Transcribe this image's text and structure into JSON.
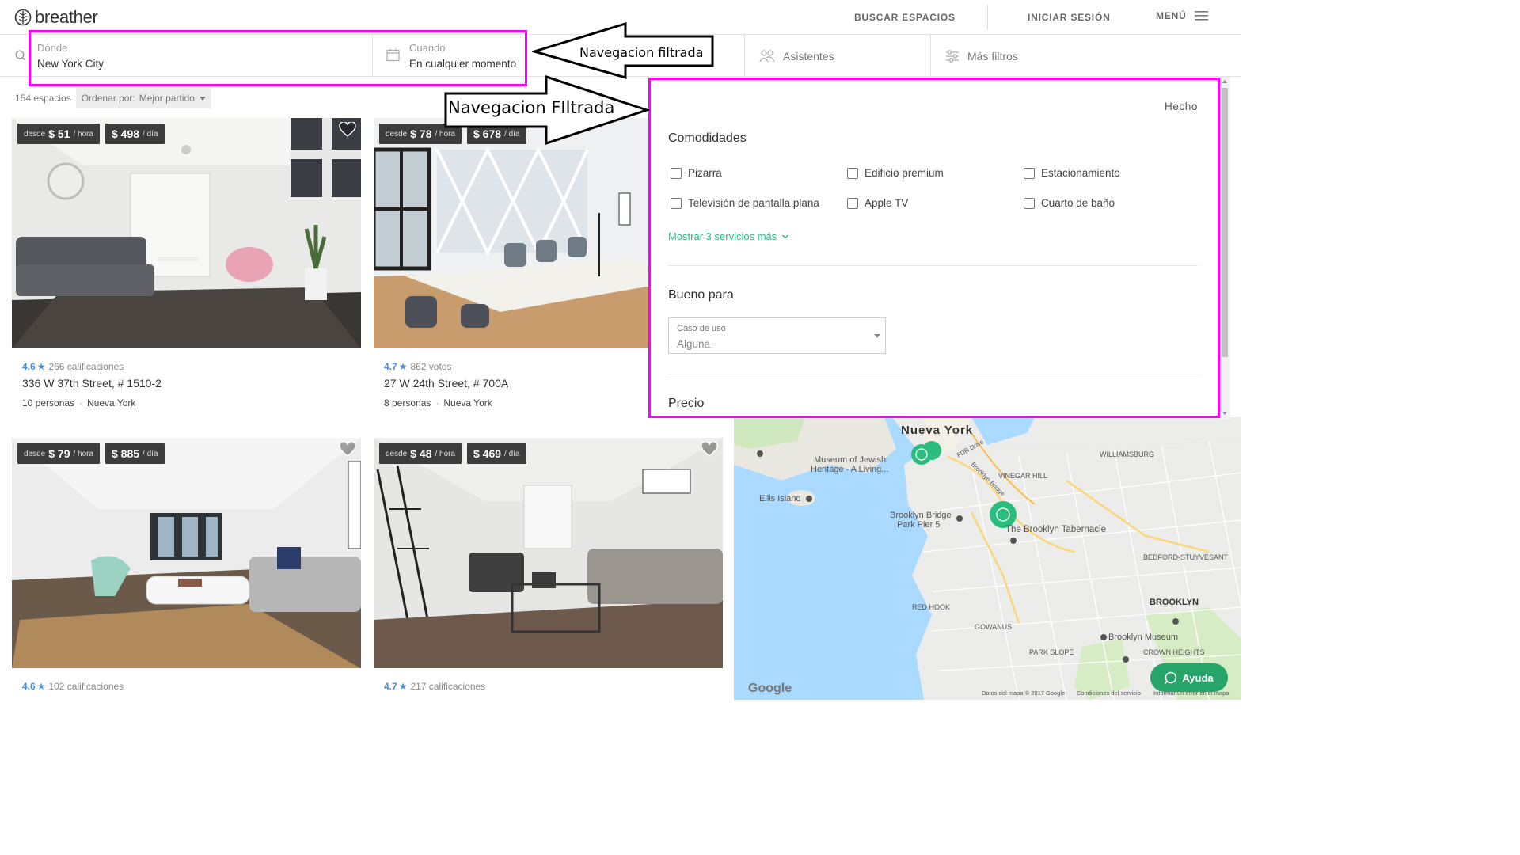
{
  "header": {
    "logo_text": "breather",
    "nav": {
      "buscar": "BUSCAR ESPACIOS",
      "iniciar": "INICIAR SESIÓN",
      "menu": "MENÚ"
    }
  },
  "filterbar": {
    "where": {
      "label": "Dónde",
      "value": "New York City"
    },
    "when": {
      "label": "Cuando",
      "value": "En cualquier momento"
    },
    "attendees": "Asistentes",
    "more_filters": "Más filtros"
  },
  "results": {
    "count": "154 espacios",
    "sort_label": "Ordenar por:",
    "sort_value": "Mejor partido",
    "cards": [
      {
        "price_hour": "$ 51",
        "price_day": "$ 498",
        "rating": "4.6",
        "reviews": "266 calificaciones",
        "address": "336 W 37th Street, # 1510-2",
        "people": "10 personas",
        "city": "Nueva York"
      },
      {
        "price_hour": "$ 78",
        "price_day": "$ 678",
        "rating": "4.7",
        "reviews": "862 votos",
        "address": "27 W 24th Street, # 700A",
        "people": "8 personas",
        "city": "Nueva York"
      },
      {
        "price_hour": "$ 79",
        "price_day": "$ 885",
        "rating": "4.6",
        "reviews": "102 calificaciones"
      },
      {
        "price_hour": "$ 48",
        "price_day": "$ 469",
        "rating": "4.7",
        "reviews": "217 calificaciones"
      }
    ],
    "from_label": "desde",
    "per_hour": "/ hora",
    "per_day": "/ día"
  },
  "filter_panel": {
    "done": "Hecho",
    "amenities_title": "Comodidades",
    "amenities": [
      "Pizarra",
      "Edificio premium",
      "Estacionamiento",
      "Televisión de pantalla plana",
      "Apple TV",
      "Cuarto de baño"
    ],
    "show_more": "Mostrar 3 servicios más",
    "good_for_title": "Bueno para",
    "use_case_label": "Caso de uso",
    "use_case_value": "Alguna",
    "price_title": "Precio"
  },
  "map": {
    "labels": {
      "nueva_york": "Nueva York",
      "museum": "Museum of Jewish",
      "museum2": "Heritage - A Living...",
      "ellis": "Ellis Island",
      "bbpark": "Brooklyn Bridge",
      "bbpark2": "Park Pier 5",
      "tabernacle": "The Brooklyn Tabernacle",
      "williamsburg": "WILLIAMSBURG",
      "vinegar": "VINEGAR HILL",
      "bedford": "BEDFORD-STUYVESANT",
      "brooklyn": "BROOKLYN",
      "red_hook": "RED HOOK",
      "gowanus": "GOWANUS",
      "park_slope": "PARK SLOPE",
      "crown": "CROWN HEIGHTS",
      "bk_museum": "Brooklyn Museum",
      "fdr": "FDR Drive",
      "bbridge": "Brooklyn Bridge"
    },
    "google": "Google",
    "attribution": "Datos del mapa © 2017 Google",
    "terms": "Condiciones del servicio",
    "report": "Informar un error en el mapa",
    "help": "Ayuda"
  },
  "annotations": {
    "arrow_top": "Navegacion filtrada",
    "arrow_bottom": "Navegacion FIltrada",
    "color": "#ff00ff"
  },
  "colors": {
    "accent_green": "#2bbd7e",
    "rating_blue": "#4a90d9",
    "help_green": "#26a46a"
  }
}
